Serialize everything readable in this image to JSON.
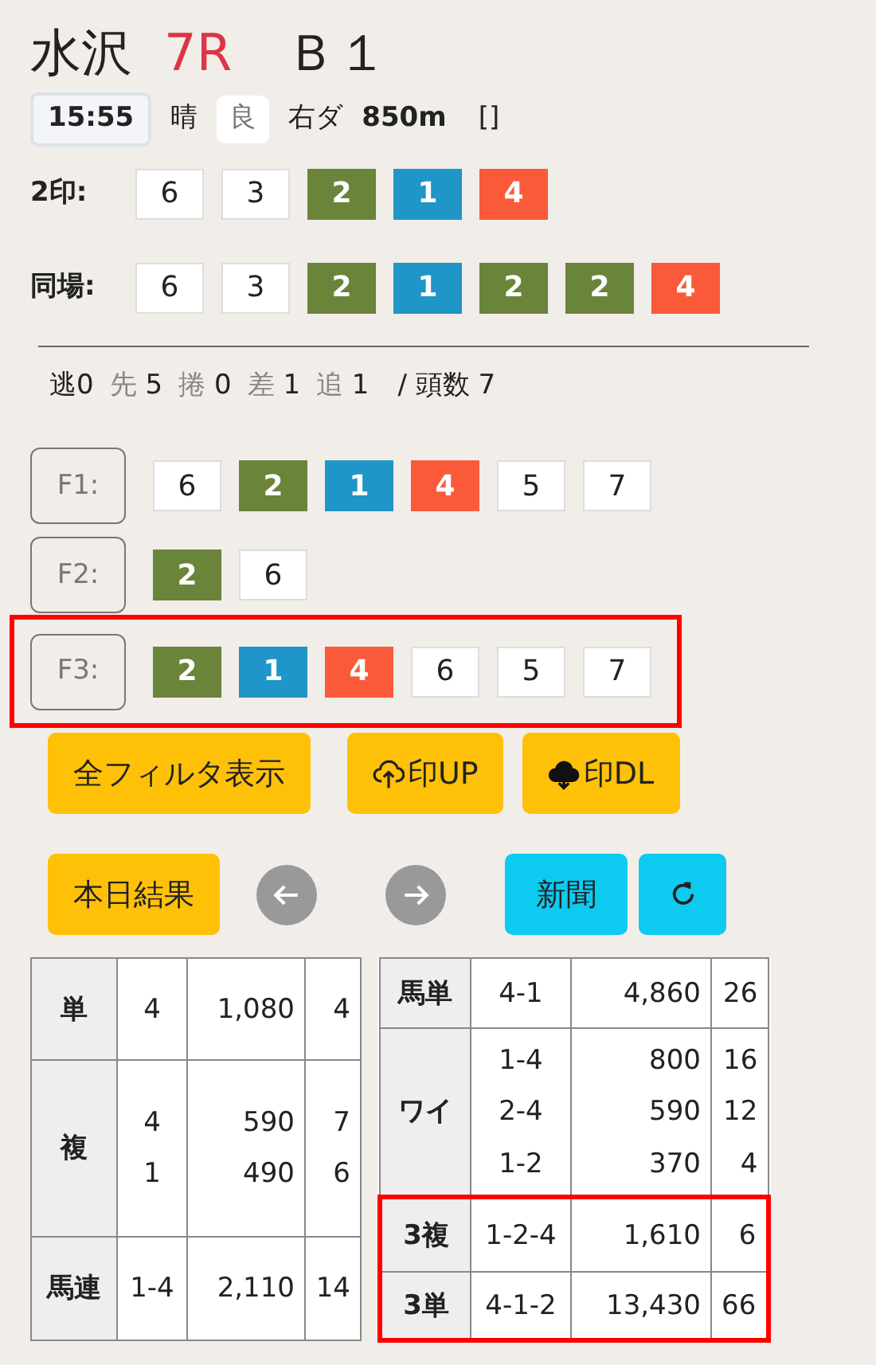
{
  "header": {
    "venue": "水沢",
    "race": "7R",
    "grade": "Ｂ１"
  },
  "info": {
    "time": "15:55",
    "weather": "晴",
    "going": "良",
    "course": "右ダ",
    "distance": "850m",
    "extra": "[]"
  },
  "mark_rows": [
    {
      "label": "2印:",
      "marks": [
        {
          "text": "6",
          "color": "#ffffff"
        },
        {
          "text": "3",
          "color": "#ffffff"
        },
        {
          "text": "2",
          "color": "#6a843a"
        },
        {
          "text": "1",
          "color": "#1f95c8"
        },
        {
          "text": "4",
          "color": "#fb5a3a"
        }
      ]
    },
    {
      "label": "同場:",
      "marks": [
        {
          "text": "6",
          "color": "#ffffff"
        },
        {
          "text": "3",
          "color": "#ffffff"
        },
        {
          "text": "2",
          "color": "#6a843a"
        },
        {
          "text": "1",
          "color": "#1f95c8"
        },
        {
          "text": "2",
          "color": "#6a843a"
        },
        {
          "text": "2",
          "color": "#6a843a"
        },
        {
          "text": "4",
          "color": "#fb5a3a"
        }
      ]
    }
  ],
  "styles": [
    {
      "label": "逃",
      "count": "0",
      "emphasized": true
    },
    {
      "label": "先",
      "count": "5",
      "emphasized": false
    },
    {
      "label": "捲",
      "count": "0",
      "emphasized": false
    },
    {
      "label": "差",
      "count": "1",
      "emphasized": false
    },
    {
      "label": "追",
      "count": "1",
      "emphasized": false
    }
  ],
  "runners": "/ 頭数 7",
  "filters": [
    {
      "label": "F1:",
      "highlighted": false,
      "marks": [
        {
          "text": "6",
          "color": "#ffffff"
        },
        {
          "text": "2",
          "color": "#6a843a"
        },
        {
          "text": "1",
          "color": "#1f95c8"
        },
        {
          "text": "4",
          "color": "#fb5a3a"
        },
        {
          "text": "5",
          "color": "#ffffff"
        },
        {
          "text": "7",
          "color": "#ffffff"
        }
      ]
    },
    {
      "label": "F2:",
      "highlighted": false,
      "marks": [
        {
          "text": "2",
          "color": "#6a843a"
        },
        {
          "text": "6",
          "color": "#ffffff"
        }
      ]
    },
    {
      "label": "F3:",
      "highlighted": true,
      "marks": [
        {
          "text": "2",
          "color": "#6a843a"
        },
        {
          "text": "1",
          "color": "#1f95c8"
        },
        {
          "text": "4",
          "color": "#fb5a3a"
        },
        {
          "text": "6",
          "color": "#ffffff"
        },
        {
          "text": "5",
          "color": "#ffffff"
        },
        {
          "text": "7",
          "color": "#ffffff"
        }
      ]
    }
  ],
  "buttons_top": [
    {
      "label": "全フィルタ表示",
      "kind": "plain"
    },
    {
      "label": "印UP",
      "kind": "upload"
    },
    {
      "label": "印DL",
      "kind": "download"
    }
  ],
  "buttons_bottom": [
    {
      "label": "本日結果",
      "kind": "results"
    },
    {
      "kind": "prev"
    },
    {
      "kind": "next"
    },
    {
      "label": "新聞",
      "kind": "paper"
    },
    {
      "kind": "reload"
    }
  ],
  "payouts_left": [
    {
      "type": "単",
      "highlighted": false,
      "combos": [
        "4"
      ],
      "payouts": [
        "1,080"
      ],
      "popularity": [
        "4"
      ]
    },
    {
      "type": "複",
      "highlighted": false,
      "combos": [
        "4",
        "1"
      ],
      "payouts": [
        "590",
        "490"
      ],
      "popularity": [
        "7",
        "6"
      ]
    },
    {
      "type": "馬連",
      "highlighted": false,
      "combos": [
        "1-4"
      ],
      "payouts": [
        "2,110"
      ],
      "popularity": [
        "14"
      ]
    }
  ],
  "payouts_right": [
    {
      "type": "馬単",
      "highlighted": false,
      "combos": [
        "4-1"
      ],
      "payouts": [
        "4,860"
      ],
      "popularity": [
        "26"
      ]
    },
    {
      "type": "ワイ",
      "highlighted": false,
      "combos": [
        "1-4",
        "2-4",
        "1-2"
      ],
      "payouts": [
        "800",
        "590",
        "370"
      ],
      "popularity": [
        "16",
        "12",
        "4"
      ]
    },
    {
      "type": "3複",
      "highlighted": true,
      "combos": [
        "1-2-4"
      ],
      "payouts": [
        "1,610"
      ],
      "popularity": [
        "6"
      ]
    },
    {
      "type": "3単",
      "highlighted": true,
      "combos": [
        "4-1-2"
      ],
      "payouts": [
        "13,430"
      ],
      "popularity": [
        "66"
      ]
    }
  ]
}
